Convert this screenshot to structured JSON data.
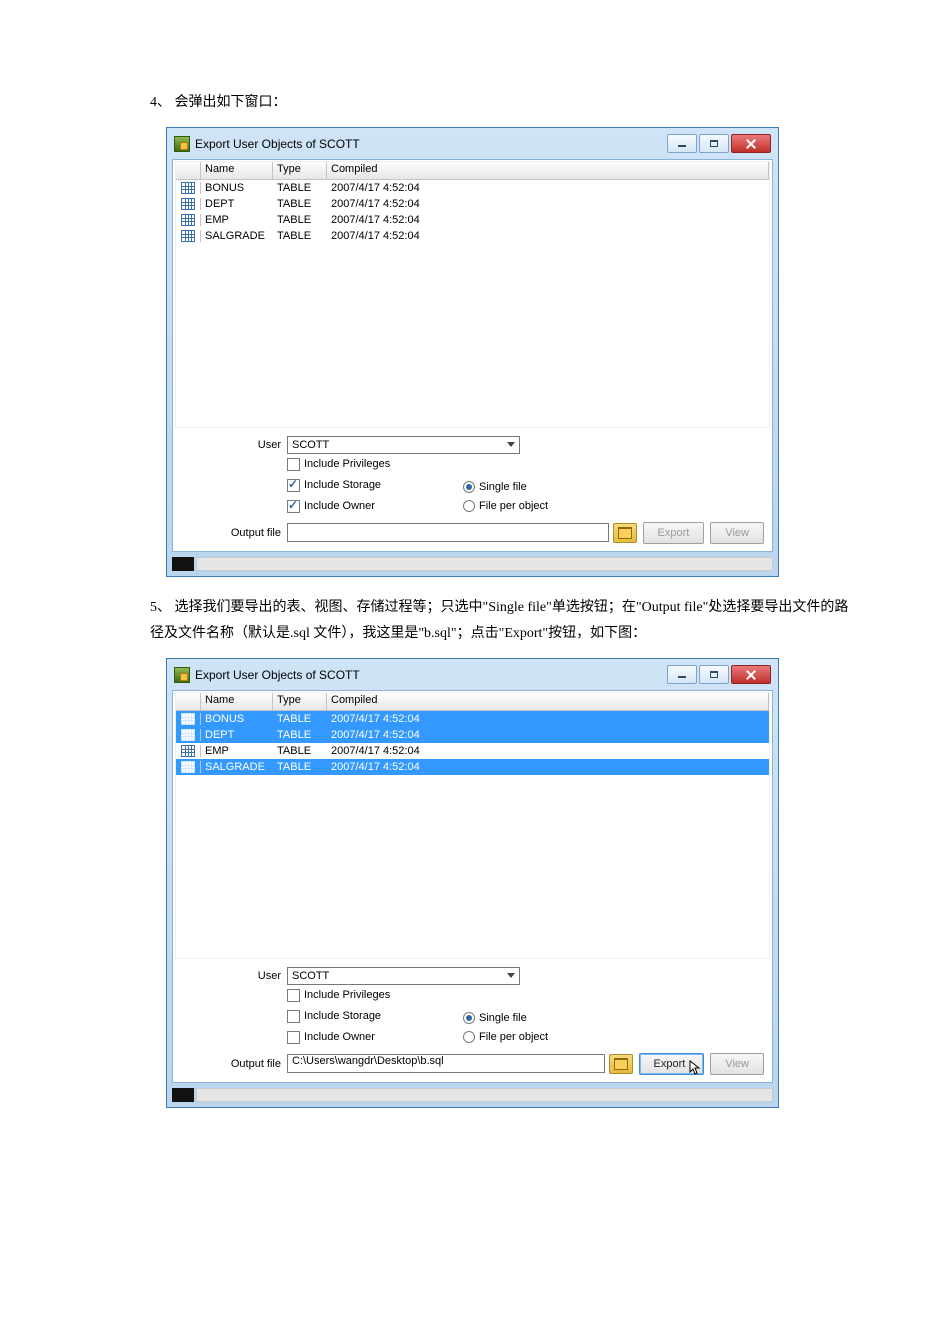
{
  "steps": {
    "s4": "4、 会弹出如下窗口：",
    "s5": "5、 选择我们要导出的表、视图、存储过程等；只选中\"Single file\"单选按钮；在\"Output file\"处选择要导出文件的路径及文件名称（默认是.sql 文件），我这里是\"b.sql\"；点击\"Export\"按钮，如下图："
  },
  "dialog1": {
    "title": "Export User Objects of SCOTT",
    "columns": {
      "name": "Name",
      "type": "Type",
      "compiled": "Compiled"
    },
    "rows": [
      {
        "name": "BONUS",
        "type": "TABLE",
        "compiled": "2007/4/17 4:52:04",
        "selected": false
      },
      {
        "name": "DEPT",
        "type": "TABLE",
        "compiled": "2007/4/17 4:52:04",
        "selected": false
      },
      {
        "name": "EMP",
        "type": "TABLE",
        "compiled": "2007/4/17 4:52:04",
        "selected": false
      },
      {
        "name": "SALGRADE",
        "type": "TABLE",
        "compiled": "2007/4/17 4:52:04",
        "selected": false
      }
    ],
    "user_label": "User",
    "user_value": "SCOTT",
    "opt_privileges": "Include Privileges",
    "opt_storage": "Include Storage",
    "opt_owner": "Include Owner",
    "opt_single": "Single file",
    "opt_perobj": "File per object",
    "privileges_checked": false,
    "storage_checked": true,
    "owner_checked": true,
    "single_checked": true,
    "perobj_checked": false,
    "output_label": "Output file",
    "output_value": "",
    "btn_export": "Export",
    "btn_view": "View",
    "export_enabled": false,
    "view_enabled": false
  },
  "dialog2": {
    "title": "Export User Objects of SCOTT",
    "columns": {
      "name": "Name",
      "type": "Type",
      "compiled": "Compiled"
    },
    "rows": [
      {
        "name": "BONUS",
        "type": "TABLE",
        "compiled": "2007/4/17 4:52:04",
        "selected": true
      },
      {
        "name": "DEPT",
        "type": "TABLE",
        "compiled": "2007/4/17 4:52:04",
        "selected": true
      },
      {
        "name": "EMP",
        "type": "TABLE",
        "compiled": "2007/4/17 4:52:04",
        "selected": false
      },
      {
        "name": "SALGRADE",
        "type": "TABLE",
        "compiled": "2007/4/17 4:52:04",
        "selected": true
      }
    ],
    "user_label": "User",
    "user_value": "SCOTT",
    "opt_privileges": "Include Privileges",
    "opt_storage": "Include Storage",
    "opt_owner": "Include Owner",
    "opt_single": "Single file",
    "opt_perobj": "File per object",
    "privileges_checked": false,
    "storage_checked": false,
    "owner_checked": false,
    "single_checked": true,
    "perobj_checked": false,
    "output_label": "Output file",
    "output_value": "C:\\Users\\wangdr\\Desktop\\b.sql",
    "btn_export": "Export",
    "btn_view": "View",
    "export_enabled": true,
    "view_enabled": false
  }
}
